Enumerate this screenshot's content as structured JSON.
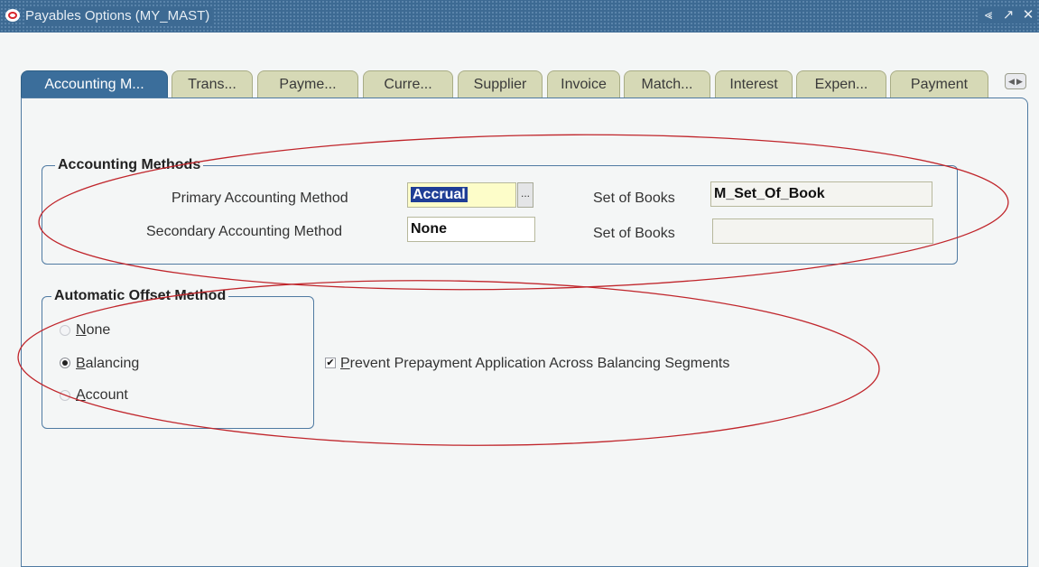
{
  "window": {
    "title": "Payables Options (MY_MAST)",
    "controls": [
      "⪡",
      "↗",
      "✕"
    ]
  },
  "tabs": [
    {
      "label": "Accounting M...",
      "active": true
    },
    {
      "label": "Trans...",
      "active": false
    },
    {
      "label": "Payme...",
      "active": false
    },
    {
      "label": "Curre...",
      "active": false
    },
    {
      "label": "Supplier",
      "active": false
    },
    {
      "label": "Invoice",
      "active": false
    },
    {
      "label": "Match...",
      "active": false
    },
    {
      "label": "Interest",
      "active": false
    },
    {
      "label": "Expen...",
      "active": false
    },
    {
      "label": "Payment",
      "active": false
    }
  ],
  "accounting_methods": {
    "title": "Accounting Methods",
    "primary_label": "Primary Accounting Method",
    "primary_value": "Accrual",
    "secondary_label": "Secondary Accounting Method",
    "secondary_value": "None",
    "sob_label_1": "Set of Books",
    "sob_value_1": "M_Set_Of_Book",
    "sob_label_2": "Set of Books",
    "sob_value_2": "",
    "lov_glyph": "..."
  },
  "offset_method": {
    "title": "Automatic Offset Method",
    "options": [
      {
        "key": "N",
        "rest": "one",
        "selected": false
      },
      {
        "key": "B",
        "rest": "alancing",
        "selected": true
      },
      {
        "key": "A",
        "rest": "ccount",
        "selected": false
      }
    ],
    "prevent_key": "P",
    "prevent_rest": "revent Prepayment Application Across Balancing Segments",
    "prevent_checked": true
  },
  "colors": {
    "titlebar": "#3d6a93",
    "active_tab": "#3b6e9b",
    "inactive_tab": "#d6d9b6",
    "required_field": "#fdfdc9",
    "annotation": "#c0252b"
  }
}
